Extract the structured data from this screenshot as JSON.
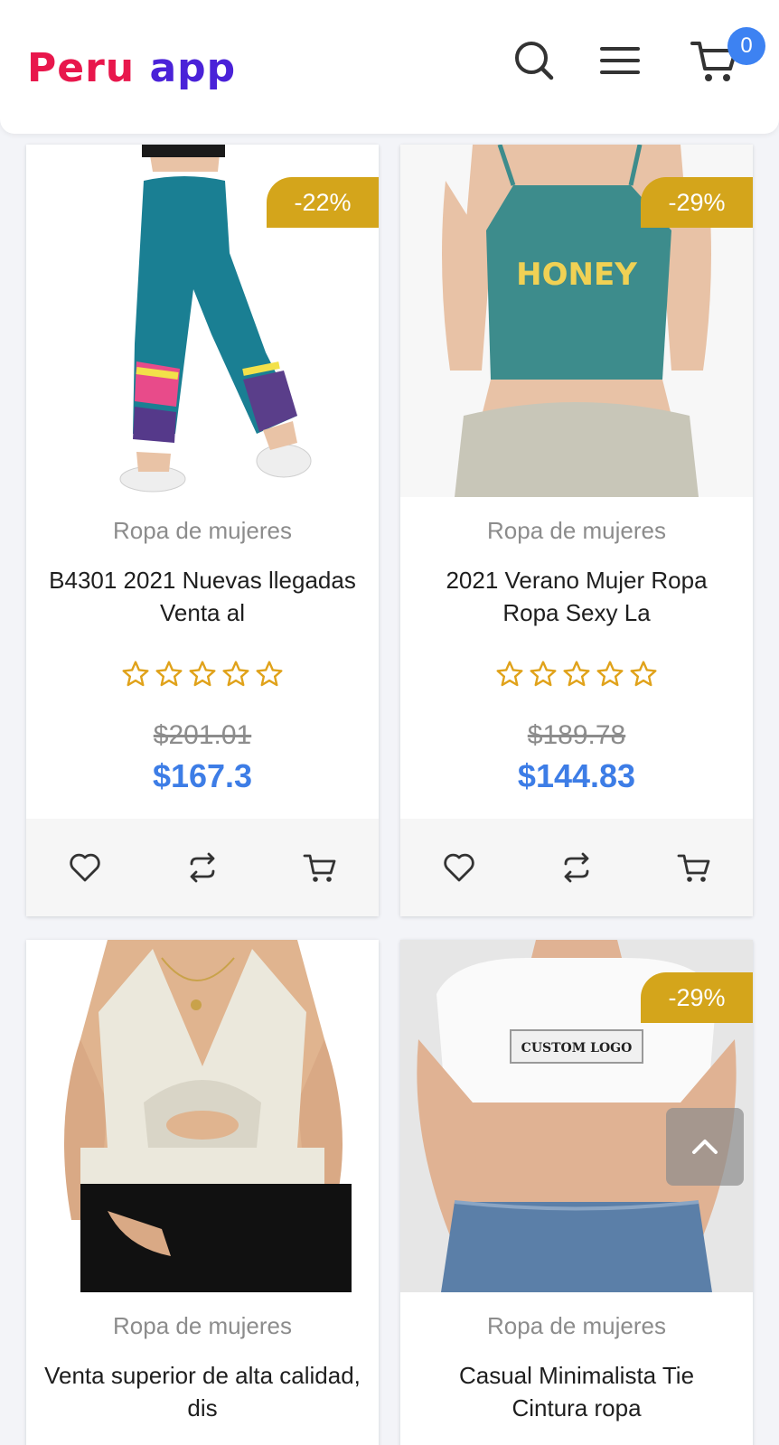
{
  "header": {
    "logo_word1": "Peru",
    "logo_word2": "app",
    "cart_count": "0",
    "icons": [
      "search-icon",
      "menu-icon",
      "cart-icon"
    ]
  },
  "colors": {
    "logo_red": "#e8174c",
    "logo_purple": "#4a22d8",
    "badge": "#d4a51b",
    "price": "#3d7de6",
    "cart_badge": "#3d82f2",
    "star": "#e0a21a"
  },
  "products": [
    {
      "category": "Ropa de mujeres",
      "title": "B4301 2021 Nuevas llegadas Venta al",
      "discount": "-22%",
      "old_price": "$201.01",
      "price": "$167.3",
      "rating": 0
    },
    {
      "category": "Ropa de mujeres",
      "title": "2021 Verano Mujer Ropa Ropa Sexy La",
      "discount": "-29%",
      "old_price": "$189.78",
      "price": "$144.83",
      "rating": 0,
      "image_text": "HONEY"
    },
    {
      "category": "Ropa de mujeres",
      "title": "Venta superior de alta calidad, dis",
      "discount": ""
    },
    {
      "category": "Ropa de mujeres",
      "title": "Casual Minimalista Tie Cintura ropa",
      "discount": "-29%",
      "image_text": "CUSTOM LOGO"
    }
  ]
}
